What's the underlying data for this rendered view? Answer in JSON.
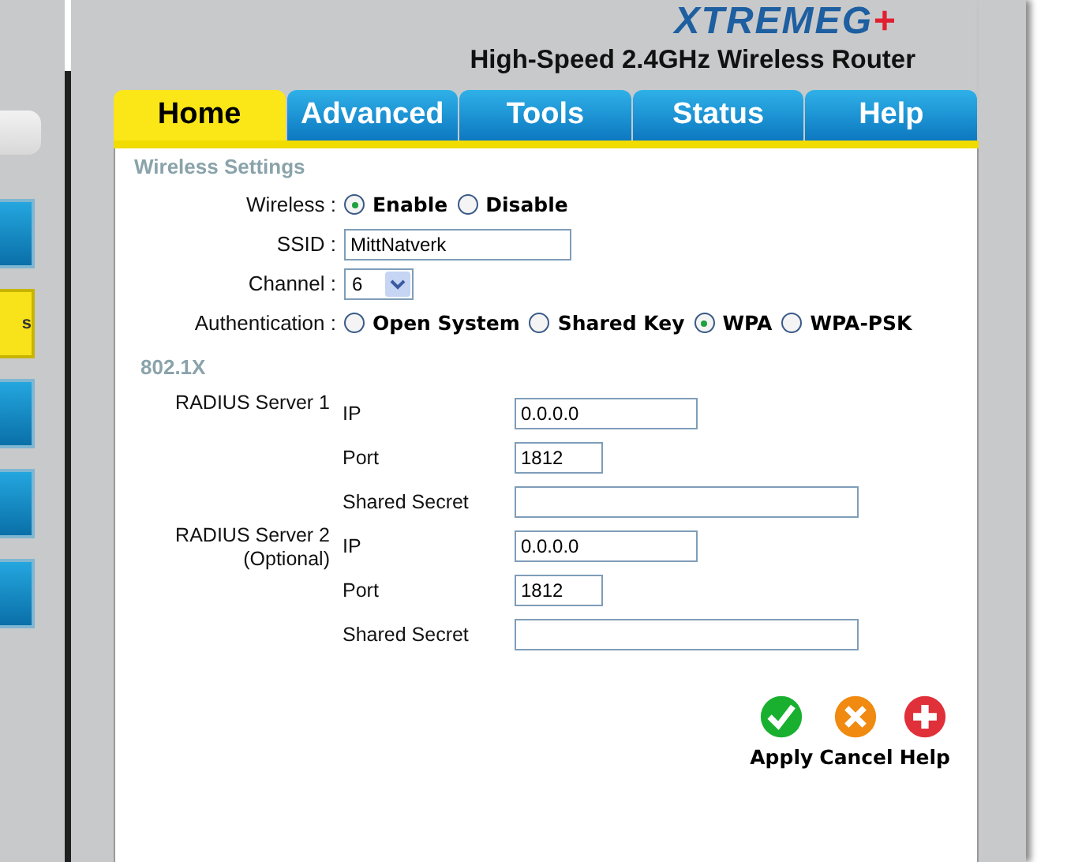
{
  "header": {
    "logo": "XTREME",
    "logo_accent": "G",
    "logo_plus": "+",
    "subtitle": "High-Speed 2.4GHz Wireless Router"
  },
  "sidebar": {
    "buttons": [
      {
        "selected": false
      },
      {
        "label": "s",
        "selected": true
      },
      {
        "selected": false
      },
      {
        "selected": false
      },
      {
        "selected": false
      }
    ]
  },
  "tabs": [
    {
      "label": "Home",
      "selected": true
    },
    {
      "label": "Advanced",
      "selected": false
    },
    {
      "label": "Tools",
      "selected": false
    },
    {
      "label": "Status",
      "selected": false
    },
    {
      "label": "Help",
      "selected": false
    }
  ],
  "wireless_settings": {
    "title": "Wireless Settings",
    "wireless": {
      "label": "Wireless :",
      "options": [
        {
          "label": "Enable",
          "selected": true
        },
        {
          "label": "Disable",
          "selected": false
        }
      ]
    },
    "ssid": {
      "label": "SSID :",
      "value": "MittNatverk"
    },
    "channel": {
      "label": "Channel :",
      "value": "6"
    },
    "authentication": {
      "label": "Authentication :",
      "options": [
        {
          "label": "Open System",
          "selected": false
        },
        {
          "label": "Shared Key",
          "selected": false
        },
        {
          "label": "WPA",
          "selected": true
        },
        {
          "label": "WPA-PSK",
          "selected": false
        }
      ]
    }
  },
  "dot1x": {
    "title": "802.1X",
    "servers": [
      {
        "label": "RADIUS Server 1",
        "ip_label": "IP",
        "ip": "0.0.0.0",
        "port_label": "Port",
        "port": "1812",
        "secret_label": "Shared Secret"
      },
      {
        "label": "RADIUS Server 2",
        "sublabel": "(Optional)",
        "ip_label": "IP",
        "ip": "0.0.0.0",
        "port_label": "Port",
        "port": "1812",
        "secret_label": "Shared Secret"
      }
    ]
  },
  "actions": [
    {
      "kind": "apply",
      "label": "Apply"
    },
    {
      "kind": "cancel",
      "label": "Cancel"
    },
    {
      "kind": "help",
      "label": "Help"
    }
  ]
}
